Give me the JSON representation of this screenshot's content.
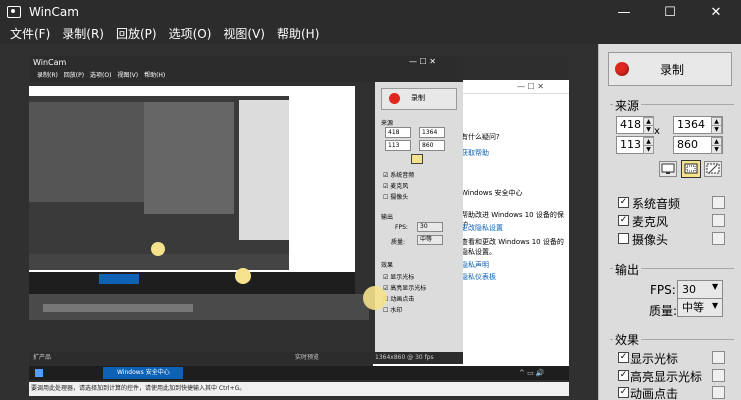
{
  "window": {
    "title": "WinCam",
    "minimize": "—",
    "maximize": "☐",
    "close": "✕"
  },
  "menu": [
    "文件(F)",
    "录制(R)",
    "回放(P)",
    "选项(O)",
    "视图(V)",
    "帮助(H)"
  ],
  "record": {
    "label": "录制",
    "color": "#e0281e"
  },
  "source": {
    "title": "来源",
    "x": "418",
    "width": "1364",
    "y": "113",
    "height": "860",
    "sep": "x",
    "icons": [
      "fullscreen-icon",
      "region-icon",
      "window-select-icon"
    ]
  },
  "sources": [
    {
      "label": "系统音频",
      "checked": true
    },
    {
      "label": "麦克风",
      "checked": true
    },
    {
      "label": "摄像头",
      "checked": false
    }
  ],
  "output": {
    "title": "输出",
    "fps_label": "FPS:",
    "fps": "30",
    "quality_label": "质量:",
    "quality": "中等"
  },
  "effects": {
    "title": "效果",
    "items": [
      {
        "label": "显示光标",
        "checked": true
      },
      {
        "label": "高亮显示光标",
        "checked": true
      },
      {
        "label": "动画点击",
        "checked": true
      }
    ]
  },
  "preview": {
    "inner_title": "WinCam",
    "inner_menu": [
      "录制(R)",
      "回放(P)",
      "选项(O)",
      "视图(V)",
      "帮助(H)"
    ],
    "inner_record": "录制",
    "inner_source_title": "来源",
    "inner_x": "418",
    "inner_w": "1364",
    "inner_y": "113",
    "inner_h": "860",
    "inner_sources": [
      "系统音频",
      "麦克风",
      "摄像头"
    ],
    "inner_output_title": "输出",
    "inner_fps_label": "FPS:",
    "inner_fps": "30",
    "inner_quality_label": "质量:",
    "inner_quality": "中等",
    "inner_effects_title": "效果",
    "inner_effects": [
      "显示光标",
      "高亮显示光标",
      "动画点击",
      "水印"
    ],
    "status_res": "1364x860 @ 30 fps",
    "status_left": "扩产品",
    "status_mid": "实时预览",
    "taskbar_app": "Windows 安全中心",
    "bottom_text": "要调用此处理器，请选择加到计算的控件，请使用此加到快捷输入其中 Ctrl+G。",
    "doc_lines": [
      "有什么疑问?",
      "获取帮助",
      "Windows 安全中心",
      "帮助改进 Windows 10 设备的保护",
      "更改隐私设置",
      "查看和更改 Windows 10 设备的",
      "隐私设置。",
      "隐私声明",
      "隐私仪表板"
    ]
  },
  "colors": {
    "accent": "#e0281e",
    "highlight": "#f5e28c",
    "taskbar": "#1e1e1e",
    "winblue": "#0d62b5"
  }
}
